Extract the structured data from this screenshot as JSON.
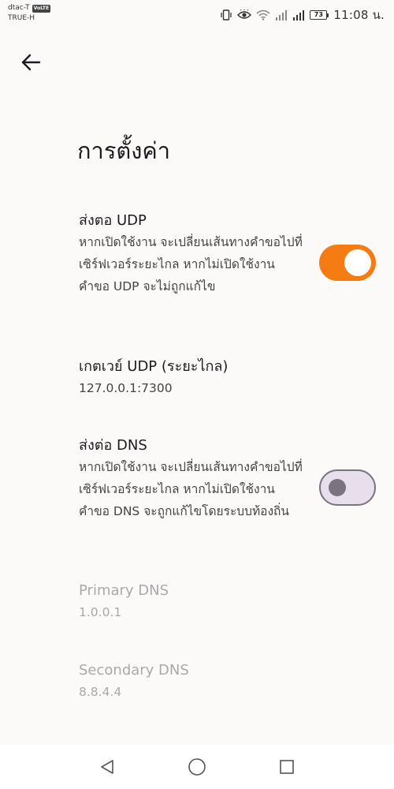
{
  "status_bar": {
    "carrier_1": "dtac-T",
    "volte_badge": "VoLTE",
    "carrier_2": "TRUE-H",
    "battery_level": "73",
    "time": "11:08 น."
  },
  "page": {
    "title": "การตั้งค่า"
  },
  "settings": {
    "udp_forward": {
      "title": "ส่งตอ UDP",
      "description": "หากเปิดใช้งาน จะเปลี่ยนเส้นทางคำขอไปที่เซิร์ฟเวอร์ระยะไกล หากไม่เปิดใช้งาน คำขอ UDP จะไม่ถูกแก้ไข",
      "enabled": true
    },
    "udp_gateway": {
      "title": "เกตเวย์ UDP (ระยะไกล)",
      "value": "127.0.0.1:7300"
    },
    "dns_forward": {
      "title": "ส่งต่อ DNS",
      "description": "หากเปิดใช้งาน จะเปลี่ยนเส้นทางคำขอไปที่เซิร์ฟเวอร์ระยะไกล หากไม่เปิดใช้งาน คำขอ DNS จะถูกแก้ไขโดยระบบท้องถิ่น",
      "enabled": false
    },
    "primary_dns": {
      "title": "Primary DNS",
      "value": "1.0.0.1"
    },
    "secondary_dns": {
      "title": "Secondary DNS",
      "value": "8.8.4.4"
    }
  },
  "colors": {
    "accent": "#f47c13",
    "background": "#fcfaf8",
    "disabled_text": "#aaa8ab"
  },
  "icons": {
    "back": "arrow-left-icon",
    "nav_back": "triangle-back-icon",
    "nav_home": "circle-home-icon",
    "nav_recent": "square-recent-icon"
  }
}
